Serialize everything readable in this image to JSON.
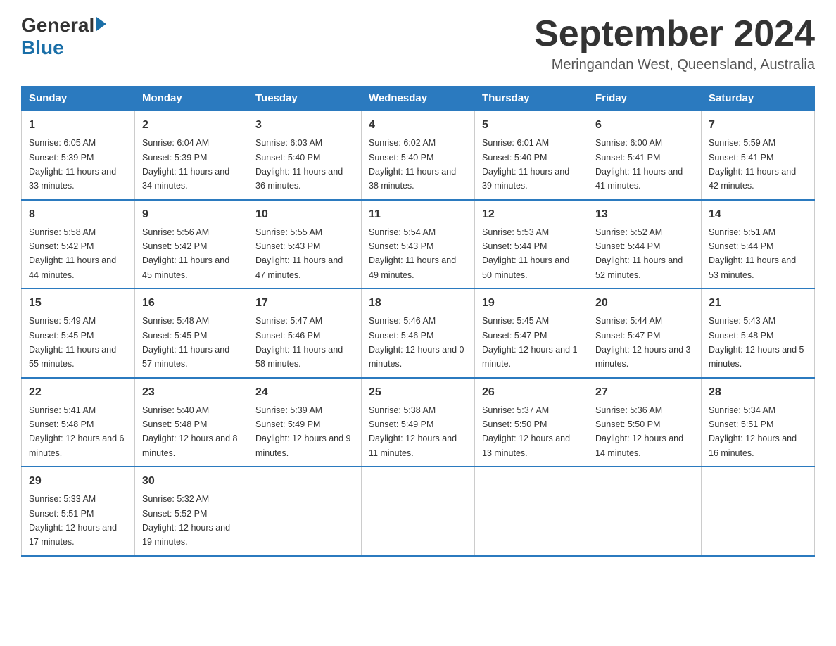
{
  "logo": {
    "general": "General",
    "blue": "Blue"
  },
  "title": "September 2024",
  "location": "Meringandan West, Queensland, Australia",
  "days_of_week": [
    "Sunday",
    "Monday",
    "Tuesday",
    "Wednesday",
    "Thursday",
    "Friday",
    "Saturday"
  ],
  "weeks": [
    [
      {
        "day": "1",
        "sunrise": "6:05 AM",
        "sunset": "5:39 PM",
        "daylight": "11 hours and 33 minutes."
      },
      {
        "day": "2",
        "sunrise": "6:04 AM",
        "sunset": "5:39 PM",
        "daylight": "11 hours and 34 minutes."
      },
      {
        "day": "3",
        "sunrise": "6:03 AM",
        "sunset": "5:40 PM",
        "daylight": "11 hours and 36 minutes."
      },
      {
        "day": "4",
        "sunrise": "6:02 AM",
        "sunset": "5:40 PM",
        "daylight": "11 hours and 38 minutes."
      },
      {
        "day": "5",
        "sunrise": "6:01 AM",
        "sunset": "5:40 PM",
        "daylight": "11 hours and 39 minutes."
      },
      {
        "day": "6",
        "sunrise": "6:00 AM",
        "sunset": "5:41 PM",
        "daylight": "11 hours and 41 minutes."
      },
      {
        "day": "7",
        "sunrise": "5:59 AM",
        "sunset": "5:41 PM",
        "daylight": "11 hours and 42 minutes."
      }
    ],
    [
      {
        "day": "8",
        "sunrise": "5:58 AM",
        "sunset": "5:42 PM",
        "daylight": "11 hours and 44 minutes."
      },
      {
        "day": "9",
        "sunrise": "5:56 AM",
        "sunset": "5:42 PM",
        "daylight": "11 hours and 45 minutes."
      },
      {
        "day": "10",
        "sunrise": "5:55 AM",
        "sunset": "5:43 PM",
        "daylight": "11 hours and 47 minutes."
      },
      {
        "day": "11",
        "sunrise": "5:54 AM",
        "sunset": "5:43 PM",
        "daylight": "11 hours and 49 minutes."
      },
      {
        "day": "12",
        "sunrise": "5:53 AM",
        "sunset": "5:44 PM",
        "daylight": "11 hours and 50 minutes."
      },
      {
        "day": "13",
        "sunrise": "5:52 AM",
        "sunset": "5:44 PM",
        "daylight": "11 hours and 52 minutes."
      },
      {
        "day": "14",
        "sunrise": "5:51 AM",
        "sunset": "5:44 PM",
        "daylight": "11 hours and 53 minutes."
      }
    ],
    [
      {
        "day": "15",
        "sunrise": "5:49 AM",
        "sunset": "5:45 PM",
        "daylight": "11 hours and 55 minutes."
      },
      {
        "day": "16",
        "sunrise": "5:48 AM",
        "sunset": "5:45 PM",
        "daylight": "11 hours and 57 minutes."
      },
      {
        "day": "17",
        "sunrise": "5:47 AM",
        "sunset": "5:46 PM",
        "daylight": "11 hours and 58 minutes."
      },
      {
        "day": "18",
        "sunrise": "5:46 AM",
        "sunset": "5:46 PM",
        "daylight": "12 hours and 0 minutes."
      },
      {
        "day": "19",
        "sunrise": "5:45 AM",
        "sunset": "5:47 PM",
        "daylight": "12 hours and 1 minute."
      },
      {
        "day": "20",
        "sunrise": "5:44 AM",
        "sunset": "5:47 PM",
        "daylight": "12 hours and 3 minutes."
      },
      {
        "day": "21",
        "sunrise": "5:43 AM",
        "sunset": "5:48 PM",
        "daylight": "12 hours and 5 minutes."
      }
    ],
    [
      {
        "day": "22",
        "sunrise": "5:41 AM",
        "sunset": "5:48 PM",
        "daylight": "12 hours and 6 minutes."
      },
      {
        "day": "23",
        "sunrise": "5:40 AM",
        "sunset": "5:48 PM",
        "daylight": "12 hours and 8 minutes."
      },
      {
        "day": "24",
        "sunrise": "5:39 AM",
        "sunset": "5:49 PM",
        "daylight": "12 hours and 9 minutes."
      },
      {
        "day": "25",
        "sunrise": "5:38 AM",
        "sunset": "5:49 PM",
        "daylight": "12 hours and 11 minutes."
      },
      {
        "day": "26",
        "sunrise": "5:37 AM",
        "sunset": "5:50 PM",
        "daylight": "12 hours and 13 minutes."
      },
      {
        "day": "27",
        "sunrise": "5:36 AM",
        "sunset": "5:50 PM",
        "daylight": "12 hours and 14 minutes."
      },
      {
        "day": "28",
        "sunrise": "5:34 AM",
        "sunset": "5:51 PM",
        "daylight": "12 hours and 16 minutes."
      }
    ],
    [
      {
        "day": "29",
        "sunrise": "5:33 AM",
        "sunset": "5:51 PM",
        "daylight": "12 hours and 17 minutes."
      },
      {
        "day": "30",
        "sunrise": "5:32 AM",
        "sunset": "5:52 PM",
        "daylight": "12 hours and 19 minutes."
      },
      null,
      null,
      null,
      null,
      null
    ]
  ],
  "labels": {
    "sunrise": "Sunrise: ",
    "sunset": "Sunset: ",
    "daylight": "Daylight: "
  }
}
